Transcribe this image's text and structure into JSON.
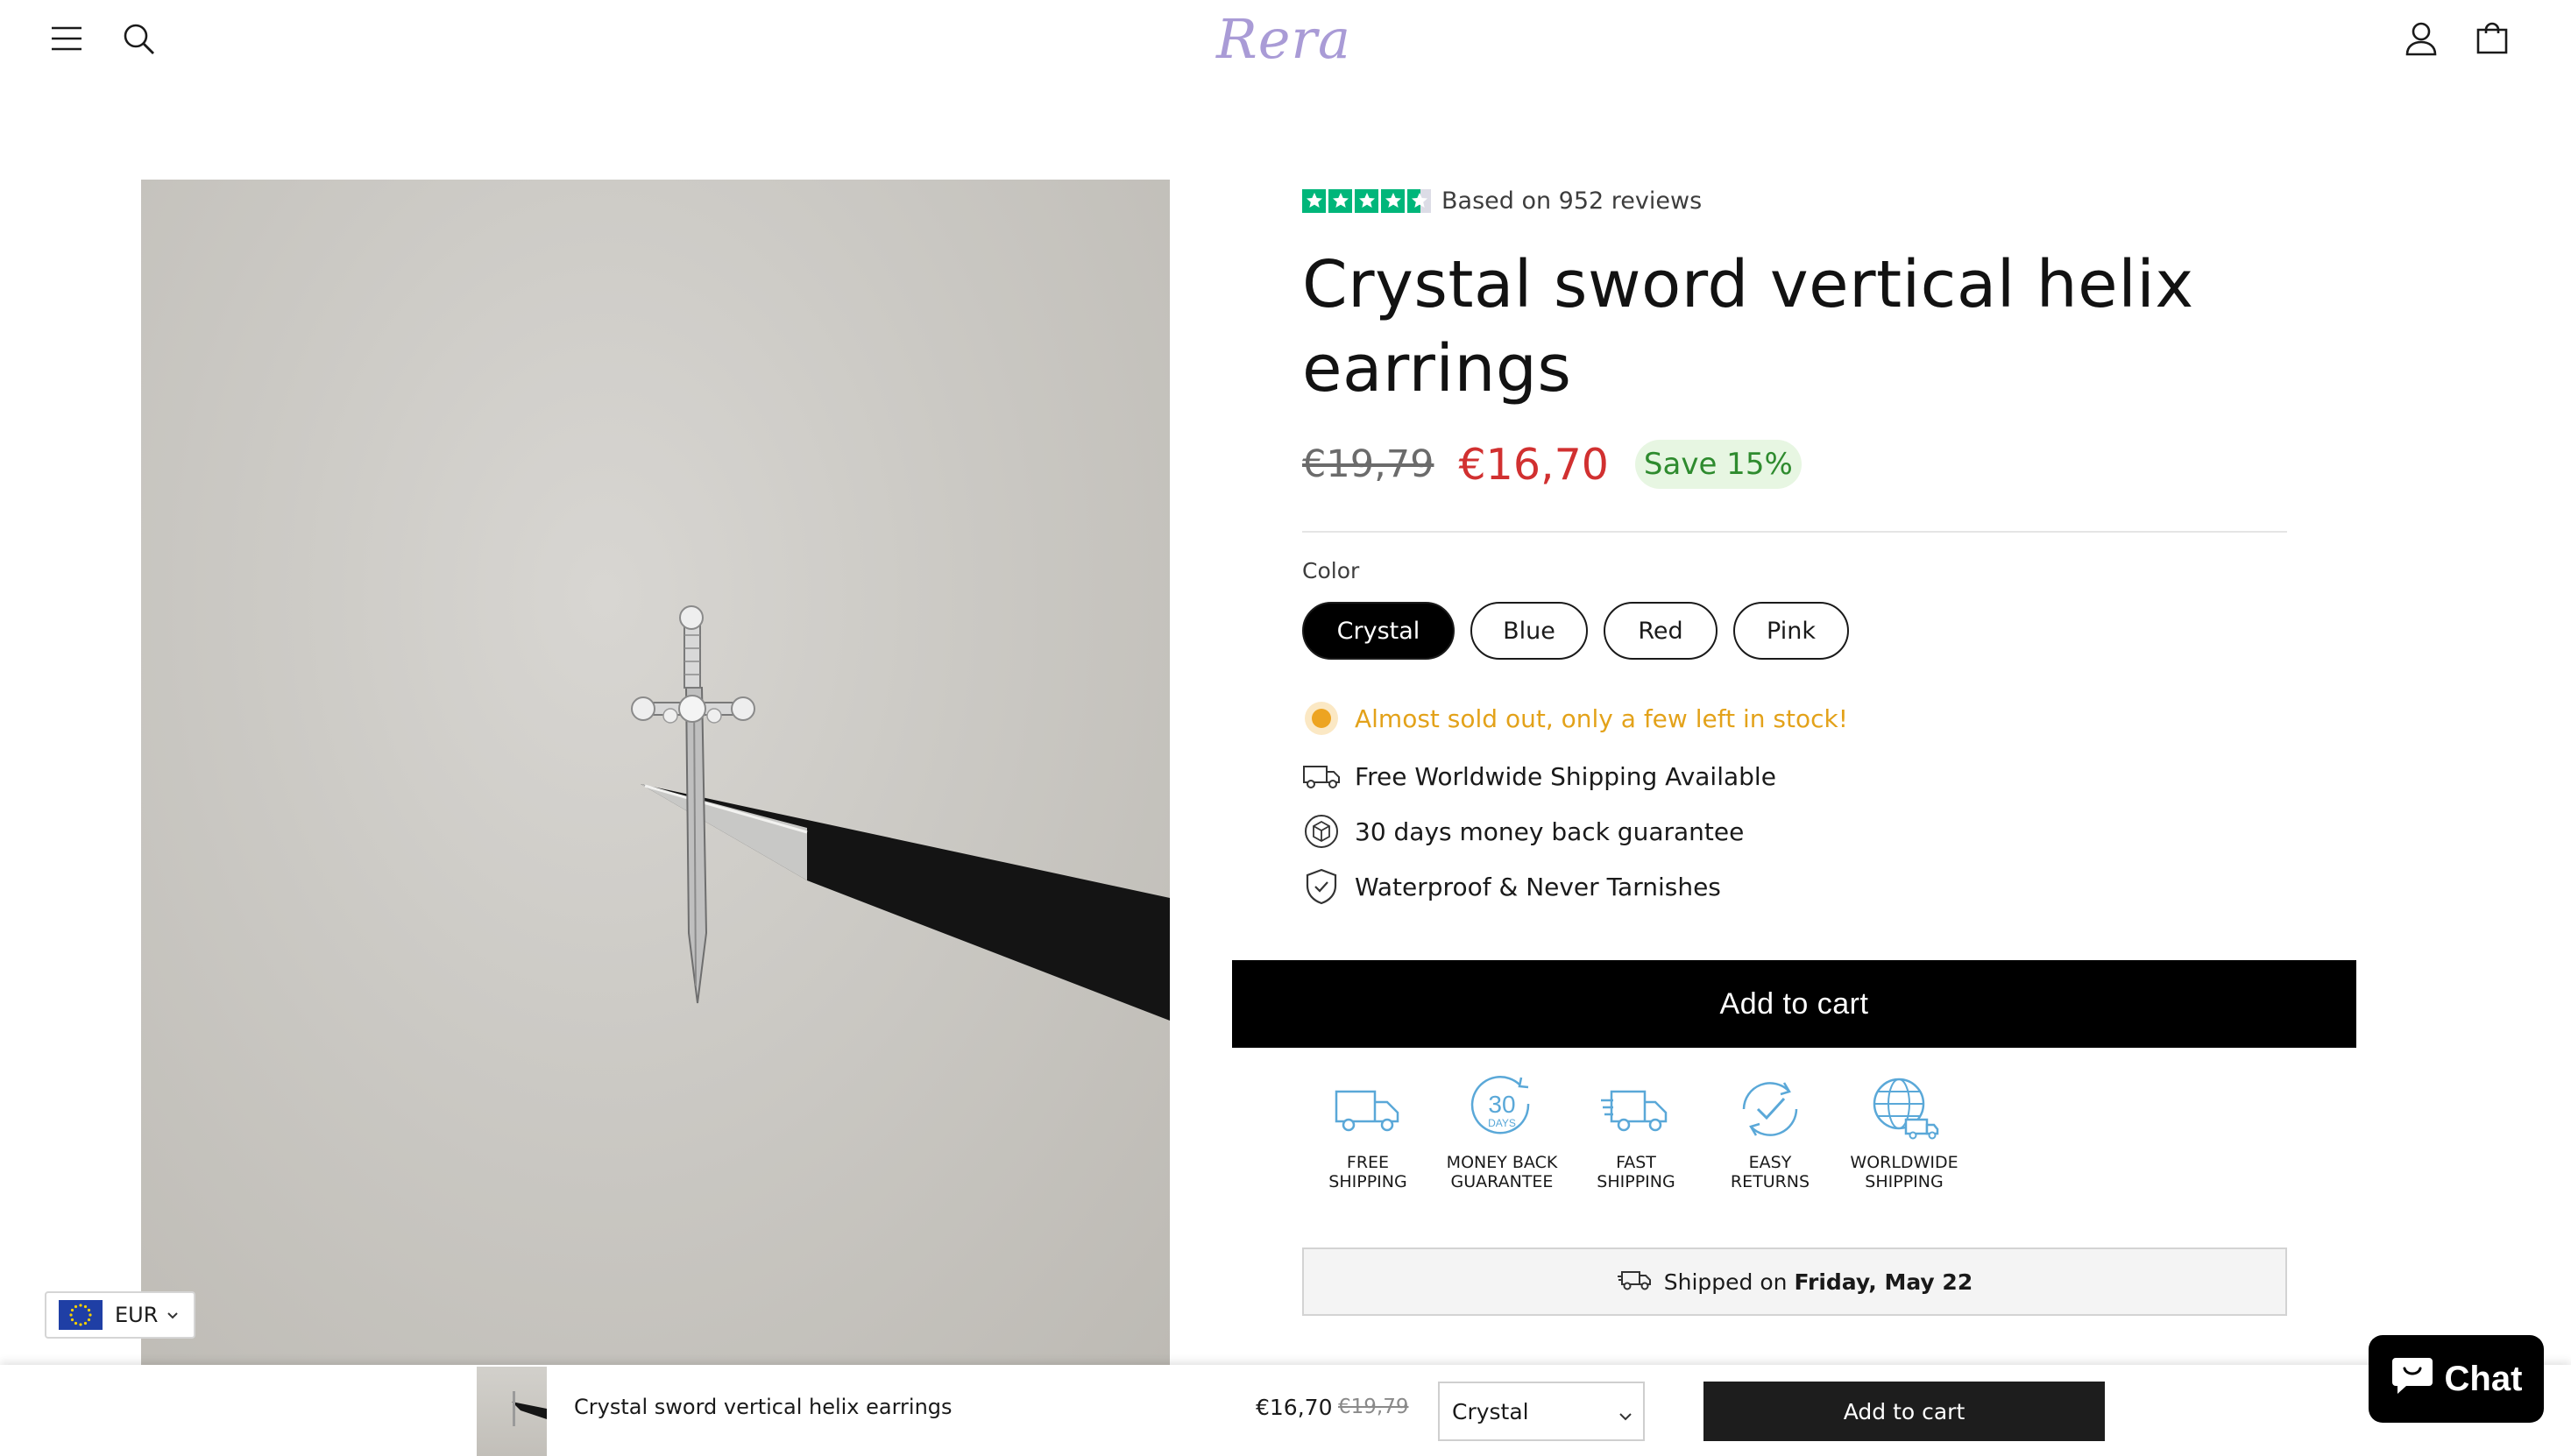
{
  "store": {
    "logo": "Rera"
  },
  "header": {
    "icons": [
      "menu-icon",
      "search-icon",
      "account-icon",
      "cart-icon"
    ]
  },
  "product": {
    "rating_text": "Based on 952 reviews",
    "rating": 4.5,
    "title": "Crystal sword vertical helix earrings",
    "old_price": "€19,79",
    "new_price": "€16,70",
    "save_badge": "Save 15%",
    "color_label": "Color",
    "colors": [
      "Crystal",
      "Blue",
      "Red",
      "Pink"
    ],
    "selected_color": "Crystal",
    "features": [
      {
        "icon": "stock-dot-icon",
        "text": "Almost sold out, only a few left in stock!"
      },
      {
        "icon": "truck-icon",
        "text": "Free Worldwide Shipping Available"
      },
      {
        "icon": "money-back-icon",
        "text": "30 days money back guarantee"
      },
      {
        "icon": "shield-icon",
        "text": "Waterproof & Never Tarnishes"
      }
    ],
    "add_to_cart": "Add to cart",
    "trust_badges": [
      {
        "icon": "free-shipping-icon",
        "line1": "FREE",
        "line2": "SHIPPING"
      },
      {
        "icon": "money-back-30-icon",
        "line1": "MONEY BACK",
        "line2": "GUARANTEE",
        "icon_text_1": "30",
        "icon_text_2": "DAYS"
      },
      {
        "icon": "fast-shipping-icon",
        "line1": "FAST",
        "line2": "SHIPPING"
      },
      {
        "icon": "easy-returns-icon",
        "line1": "EASY",
        "line2": "RETURNS"
      },
      {
        "icon": "worldwide-shipping-icon",
        "line1": "WORLDWIDE",
        "line2": "SHIPPING"
      }
    ],
    "shipped_prefix": "Shipped on",
    "shipped_date": "Friday, May 22"
  },
  "sticky_bar": {
    "title": "Crystal sword vertical helix earrings",
    "price": "€16,70",
    "old_price": "€19,79",
    "selected_variant": "Crystal",
    "button": "Add to cart"
  },
  "currency": {
    "code": "EUR"
  },
  "chat": {
    "label": "Chat"
  },
  "colors": {
    "rating_green": "#00b67a",
    "sale_red": "#d13030",
    "save_green": "#2e8b2e",
    "stock_orange": "#e3a21a",
    "badge_blue": "#5aa8d8",
    "logo_lavender": "#a99bd6"
  }
}
